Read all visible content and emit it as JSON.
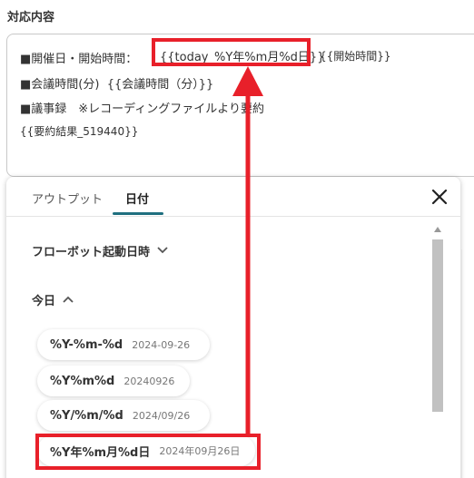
{
  "section": {
    "title": "対応内容"
  },
  "editor": {
    "line1_label": "■開催日・開始時間：",
    "line1_var": "{{today_%Y年%m月%d日}}",
    "line1_tail": "{{開始時間}}",
    "line2_label": "■会議時間(分)",
    "line2_var": "{{会議時間（分）}}",
    "line3_label": "■議事録　※レコーディングファイルより要約",
    "line4_var": "{{要約結果_519440}}"
  },
  "panel": {
    "tabs": [
      {
        "label": "アウトプット",
        "active": false
      },
      {
        "label": "日付",
        "active": true
      }
    ],
    "close_icon": "close-icon",
    "groups": {
      "flow": "フローボット起動日時",
      "today": "今日"
    },
    "formats": [
      {
        "format": "%Y-%m-%d",
        "example": "2024-09-26"
      },
      {
        "format": "%Y%m%d",
        "example": "20240926"
      },
      {
        "format": "%Y/%m/%d",
        "example": "2024/09/26"
      },
      {
        "format": "%Y年%m月%d日",
        "example": "2024年09月26日"
      }
    ]
  },
  "colors": {
    "highlight": "#e8202a",
    "tab_accent": "#1f6f7f"
  }
}
